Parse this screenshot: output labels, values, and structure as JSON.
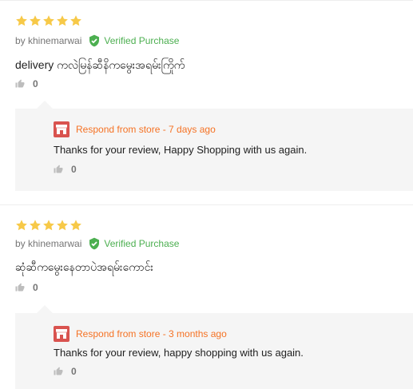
{
  "colors": {
    "star": "#f7c948",
    "verified": "#4caf50",
    "respond": "#f57224",
    "reply_bg": "#f5f5f5"
  },
  "icons": {
    "star": "star-icon",
    "verified": "shield-check-icon",
    "like": "thumbs-up-icon",
    "store": "store-icon"
  },
  "reviews": [
    {
      "rating": 5,
      "author": "by khinemarwai",
      "verified_label": "Verified Purchase",
      "content": "delivery ကလဲမြန်ဆီနိကမွေးအရမ်းကြိုက်",
      "likes": "0",
      "reply": {
        "header": "Respond from store - 7 days ago",
        "text": "Thanks for your review, Happy Shopping with us again.",
        "likes": "0"
      }
    },
    {
      "rating": 5,
      "author": "by khinemarwai",
      "verified_label": "Verified Purchase",
      "content": "ဆုံဆီကမွေးနေတာပဲအရမ်းကောင်း",
      "likes": "0",
      "reply": {
        "header": "Respond from store - 3 months ago",
        "text": "Thanks for your review, happy shopping with us again.",
        "likes": "0"
      }
    }
  ]
}
